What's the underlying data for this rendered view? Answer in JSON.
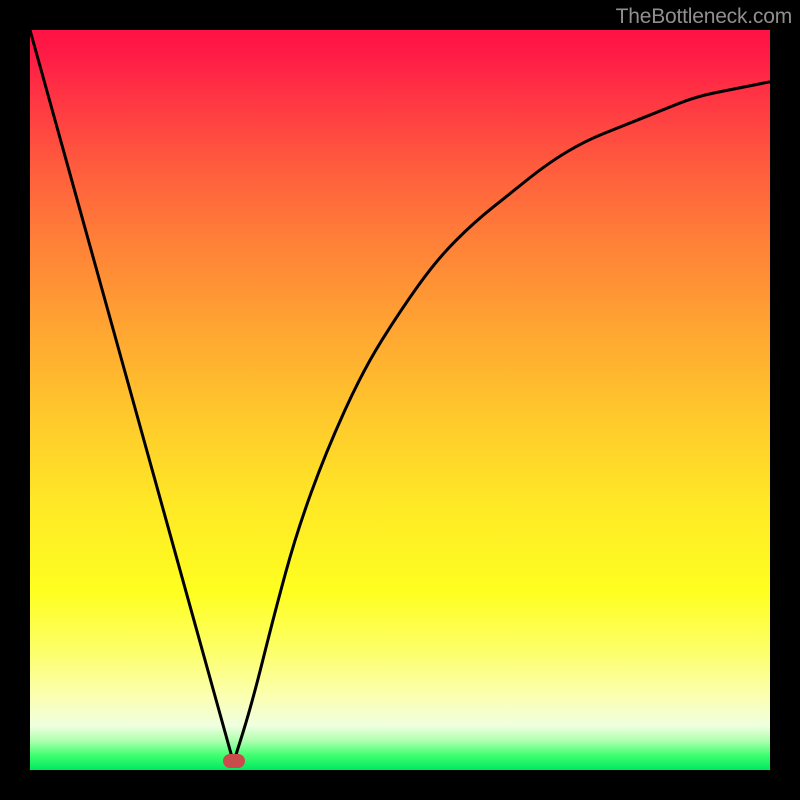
{
  "watermark": "TheBottleneck.com",
  "marker": {
    "x_frac": 0.275,
    "y_frac": 0.988,
    "color": "#c94b4b"
  },
  "chart_data": {
    "type": "line",
    "title": "",
    "xlabel": "",
    "ylabel": "",
    "xlim": [
      0,
      1
    ],
    "ylim": [
      0,
      1
    ],
    "annotations": [
      "TheBottleneck.com"
    ],
    "series": [
      {
        "name": "bottleneck-curve",
        "x": [
          0.0,
          0.05,
          0.1,
          0.15,
          0.2,
          0.25,
          0.275,
          0.3,
          0.33,
          0.36,
          0.4,
          0.45,
          0.5,
          0.55,
          0.6,
          0.65,
          0.7,
          0.75,
          0.8,
          0.85,
          0.9,
          0.95,
          1.0
        ],
        "y": [
          1.0,
          0.82,
          0.64,
          0.46,
          0.28,
          0.1,
          0.01,
          0.09,
          0.21,
          0.32,
          0.43,
          0.54,
          0.62,
          0.69,
          0.74,
          0.78,
          0.82,
          0.85,
          0.87,
          0.89,
          0.91,
          0.92,
          0.93
        ]
      }
    ],
    "marker_point": {
      "x": 0.275,
      "y": 0.012,
      "color": "#c94b4b"
    },
    "gradient": {
      "top_color": "#ff1244",
      "bottom_color": "#00e860",
      "meaning": "red-high to green-low"
    }
  }
}
